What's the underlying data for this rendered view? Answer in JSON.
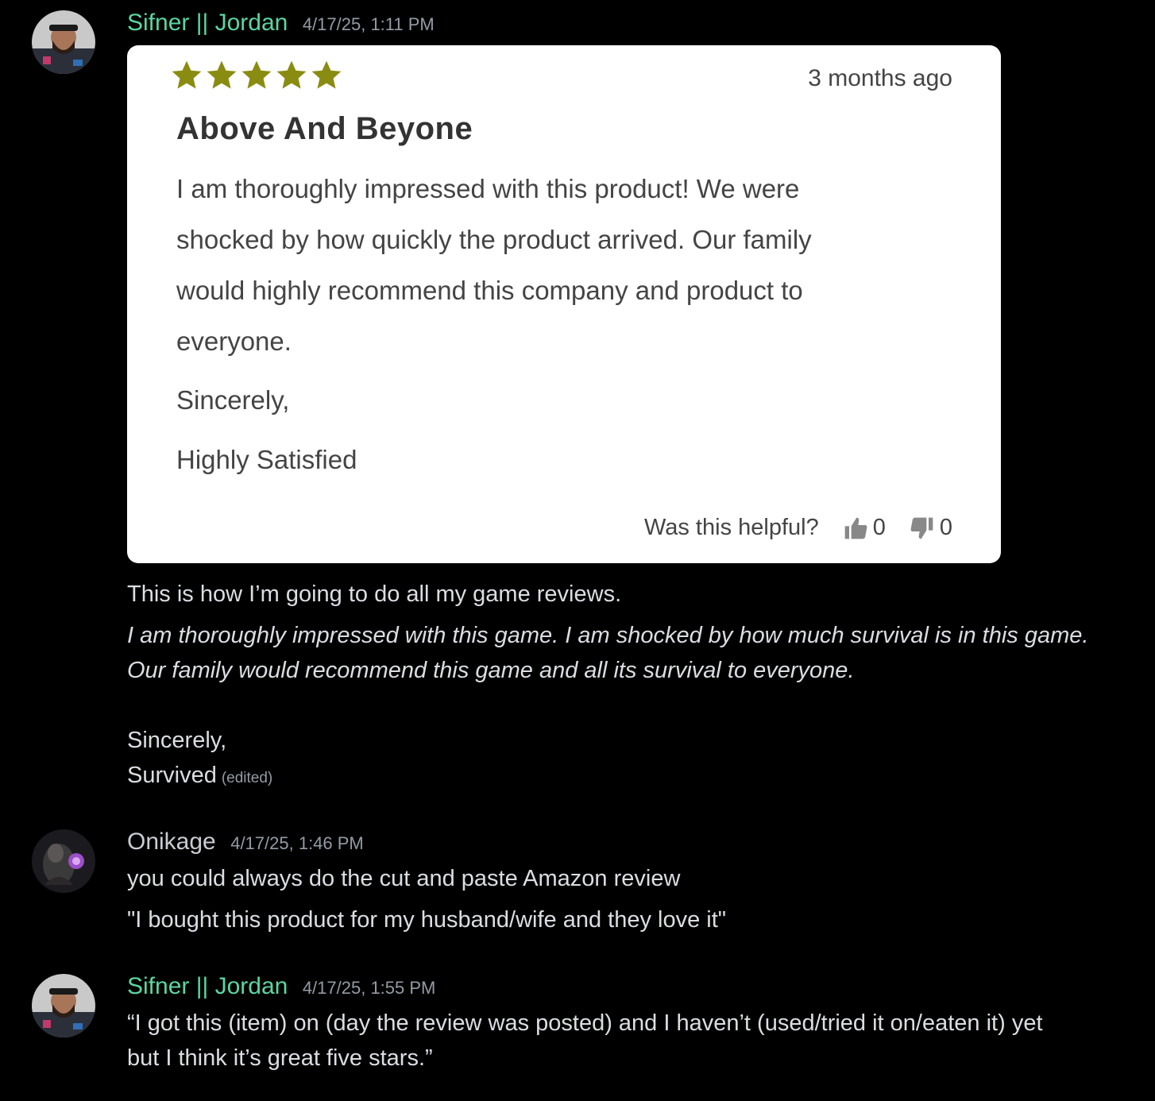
{
  "colors": {
    "background": "#000000",
    "username_jordan": "#5bd6a2",
    "username_onikage": "#c9ccd1",
    "message_text": "#dbdee1",
    "timestamp": "#949ba4",
    "star_color": "#8a8c12",
    "card_bg": "#ffffff"
  },
  "messages": [
    {
      "author": "Sifner || Jordan",
      "timestamp": "4/17/25, 1:11 PM",
      "review": {
        "stars": 5,
        "age": "3 months ago",
        "title": "Above And Beyone",
        "body_lines": [
          "I am thoroughly impressed with this product! We were",
          "shocked by how quickly the product arrived. Our family",
          "would highly recommend this company and product to",
          "everyone."
        ],
        "signoff": "Sincerely,",
        "signature": "Highly Satisfied",
        "helpful_label": "Was this helpful?",
        "thumbs_up_count": "0",
        "thumbs_down_count": "0",
        "thumbs_up_icon": "thumbs-up-icon",
        "thumbs_down_icon": "thumbs-down-icon"
      },
      "text_intro": "This is how I’m going to do all my game reviews.",
      "text_italic_1": "I am thoroughly impressed with this game. I am shocked by how much survival is in this game.",
      "text_italic_2": "Our family would recommend this game and all its survival to everyone.",
      "text_sincerely": "Sincerely,",
      "text_survived": "Survived",
      "edited_tag": "(edited)"
    },
    {
      "author": "Onikage",
      "timestamp": "4/17/25, 1:46 PM",
      "line_1": "you could always do the cut and paste Amazon review",
      "line_2": "\"I bought this product for my husband/wife and they love it\""
    },
    {
      "author": "Sifner || Jordan",
      "timestamp": "4/17/25, 1:55 PM",
      "line_1": "“I got this (item) on (day the review was posted) and I haven’t (used/tried it on/eaten it) yet",
      "line_2": "but I think it’s great five stars.”"
    }
  ]
}
